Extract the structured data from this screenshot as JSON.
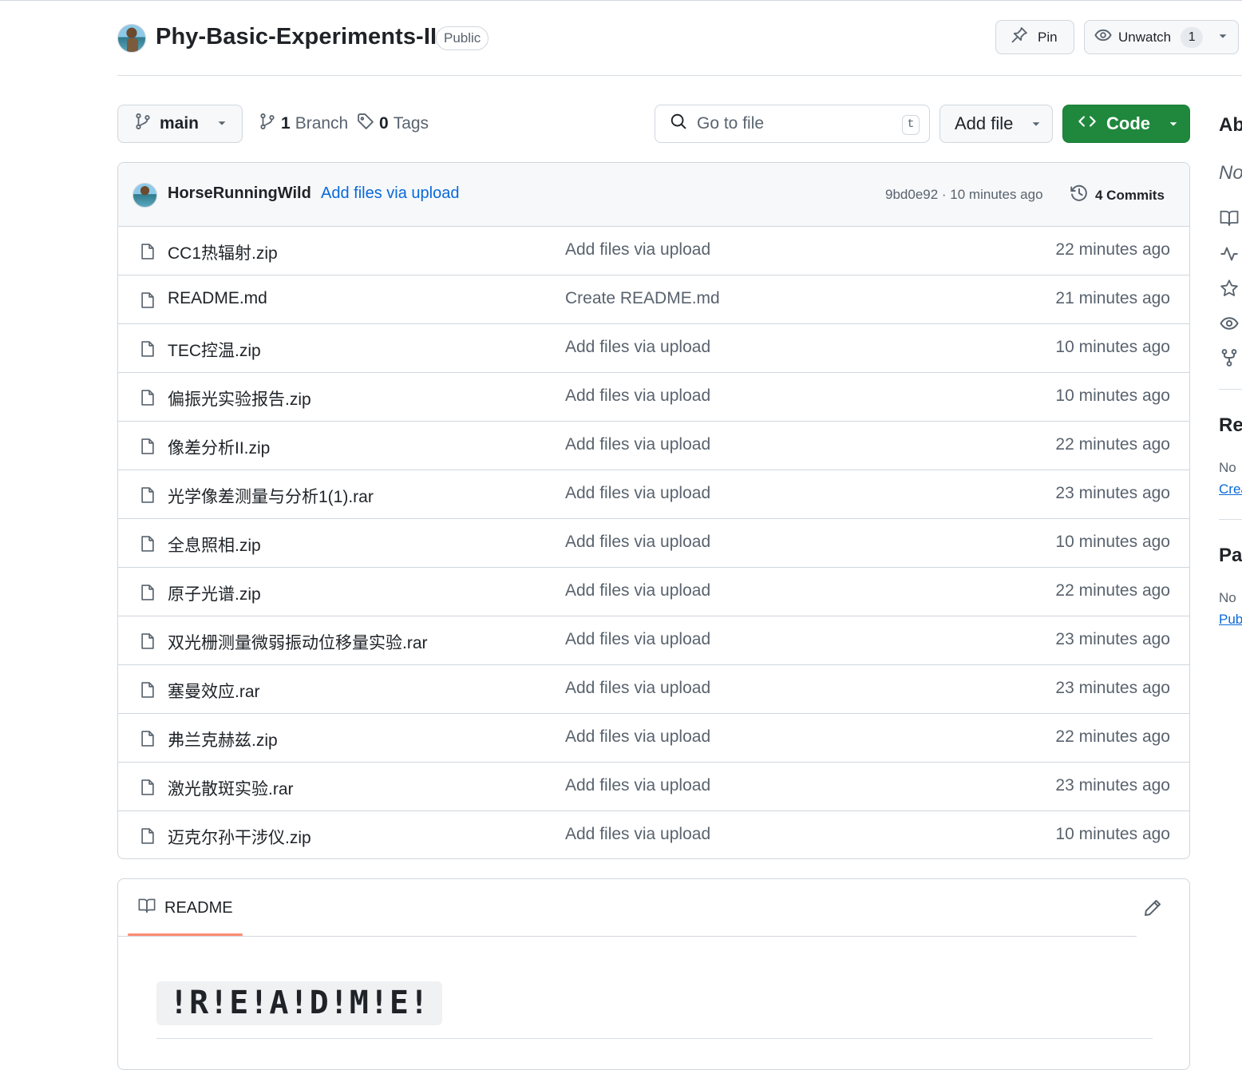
{
  "repo": {
    "name": "Phy-Basic-Experiments-II",
    "visibility": "Public",
    "pin_label": "Pin",
    "unwatch_label": "Unwatch",
    "watch_count": "1"
  },
  "toolbar": {
    "branch": "main",
    "branch_count": "1",
    "branch_label": "Branch",
    "tag_count": "0",
    "tag_label": "Tags",
    "go_to_file_placeholder": "Go to file",
    "shortcut_key": "t",
    "add_file_label": "Add file",
    "code_label": "Code"
  },
  "latest_commit": {
    "author": "HorseRunningWild",
    "message": "Add files via upload",
    "hash_time": "9bd0e92 · 10 minutes ago",
    "commits_label": "4 Commits"
  },
  "files": [
    {
      "name": "CC1热辐射.zip",
      "commit": "Add files via upload",
      "time": "22 minutes ago"
    },
    {
      "name": "README.md",
      "commit": "Create README.md",
      "time": "21 minutes ago"
    },
    {
      "name": "TEC控温.zip",
      "commit": "Add files via upload",
      "time": "10 minutes ago"
    },
    {
      "name": "偏振光实验报告.zip",
      "commit": "Add files via upload",
      "time": "10 minutes ago"
    },
    {
      "name": "像差分析II.zip",
      "commit": "Add files via upload",
      "time": "22 minutes ago"
    },
    {
      "name": "光学像差测量与分析1(1).rar",
      "commit": "Add files via upload",
      "time": "23 minutes ago"
    },
    {
      "name": "全息照相.zip",
      "commit": "Add files via upload",
      "time": "10 minutes ago"
    },
    {
      "name": "原子光谱.zip",
      "commit": "Add files via upload",
      "time": "22 minutes ago"
    },
    {
      "name": "双光栅测量微弱振动位移量实验.rar",
      "commit": "Add files via upload",
      "time": "23 minutes ago"
    },
    {
      "name": "塞曼效应.rar",
      "commit": "Add files via upload",
      "time": "23 minutes ago"
    },
    {
      "name": "弗兰克赫兹.zip",
      "commit": "Add files via upload",
      "time": "22 minutes ago"
    },
    {
      "name": "激光散斑实验.rar",
      "commit": "Add files via upload",
      "time": "23 minutes ago"
    },
    {
      "name": "迈克尔孙干涉仪.zip",
      "commit": "Add files via upload",
      "time": "10 minutes ago"
    }
  ],
  "readme": {
    "tab_label": "README",
    "heading": "!R!E!A!D!M!E!"
  },
  "sidebar": {
    "about_heading": "Ab",
    "about_desc": "No",
    "releases_heading": "Rel",
    "releases_text": "No",
    "releases_link": "Crea",
    "packages_heading": "Pac",
    "packages_text": "No",
    "packages_link": "Pub"
  },
  "colors": {
    "accent_link": "#0969da",
    "code_button": "#1f883d",
    "tab_underline": "#fd8c73"
  }
}
